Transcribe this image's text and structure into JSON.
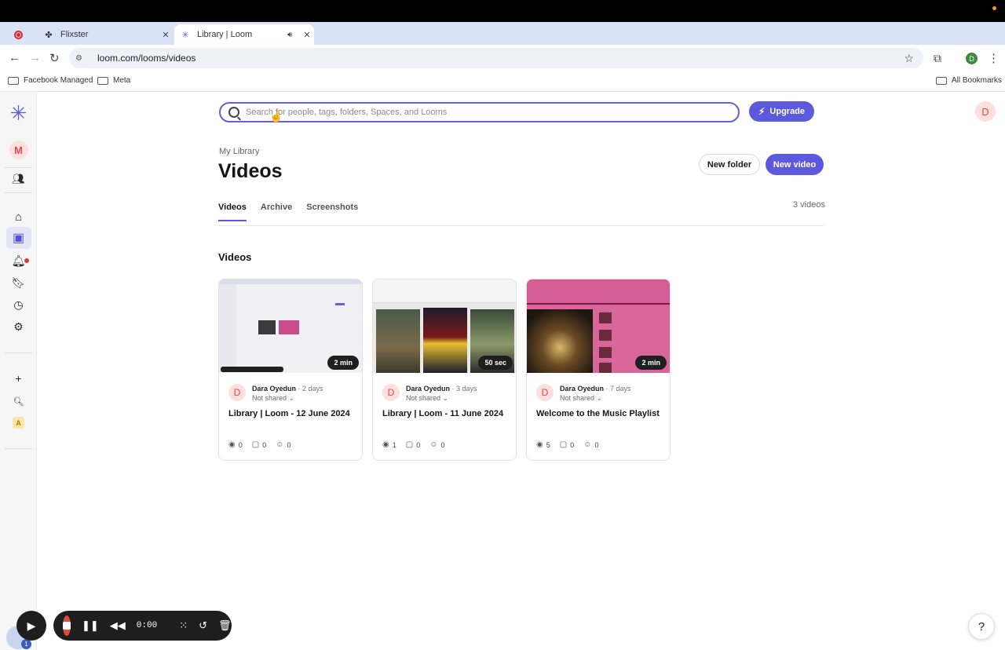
{
  "browser": {
    "tabs": [
      {
        "label": "Flixster",
        "icon": "flixster-favicon"
      },
      {
        "label": "Library | Loom",
        "icon": "loom-favicon"
      }
    ],
    "url": "loom.com/looms/videos",
    "profile_initial": "D",
    "bookmarks": [
      {
        "label": "Facebook Managed"
      },
      {
        "label": "Meta"
      }
    ],
    "all_bookmarks": "All Bookmarks"
  },
  "sidebar": {
    "workspace_initial": "M",
    "add_label": "+",
    "app_initial": "A"
  },
  "header": {
    "search_placeholder": "Search for people, tags, folders, Spaces, and Looms",
    "upgrade_label": "Upgrade",
    "user_initial": "D"
  },
  "page": {
    "breadcrumb": "My Library",
    "title": "Videos",
    "new_folder_label": "New folder",
    "new_video_label": "New video",
    "tabs": [
      "Videos",
      "Archive",
      "Screenshots"
    ],
    "count_label": "3 videos",
    "section_title": "Videos"
  },
  "videos": [
    {
      "duration": "2 min",
      "author_initial": "D",
      "author": "Dara Oyedun",
      "age": "· 2 days",
      "sharing": "Not shared",
      "title": "Library | Loom - 12 June 2024",
      "views": "0",
      "comments": "0",
      "reactions": "0"
    },
    {
      "duration": "50 sec",
      "author_initial": "D",
      "author": "Dara Oyedun",
      "age": "· 3 days",
      "sharing": "Not shared",
      "title": "Library | Loom - 11 June 2024",
      "views": "1",
      "comments": "0",
      "reactions": "0"
    },
    {
      "duration": "2 min",
      "author_initial": "D",
      "author": "Dara Oyedun",
      "age": "· 7 days",
      "sharing": "Not shared",
      "title": "Welcome to the Music Playlist",
      "views": "5",
      "comments": "0",
      "reactions": "0"
    }
  ],
  "recorder": {
    "time": "0:00",
    "badge_count": "1"
  },
  "help_label": "?",
  "colors": {
    "accent": "#5c59dd",
    "avatar_bg": "#fde0dd",
    "record_red": "#e14b3f"
  }
}
